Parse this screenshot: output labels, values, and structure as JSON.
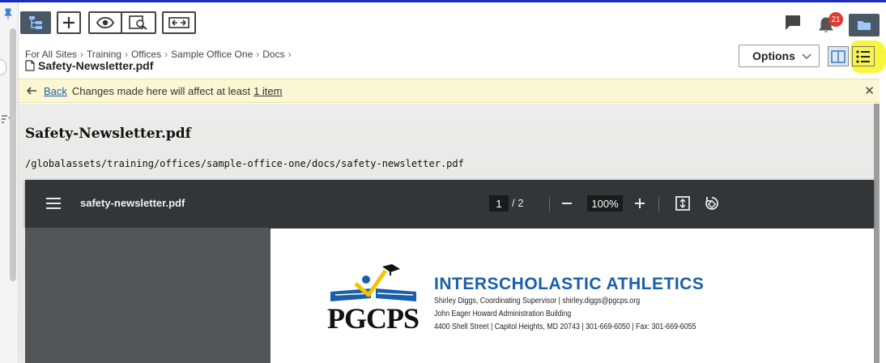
{
  "toolbar": {
    "notification_count": "21"
  },
  "breadcrumbs": [
    "For All Sites",
    "Training",
    "Offices",
    "Sample Office One",
    "Docs"
  ],
  "file": {
    "name": "Safety-Newsletter.pdf"
  },
  "options": {
    "label": "Options"
  },
  "notice": {
    "back": "Back",
    "message": "Changes made here will affect at least",
    "link": "1 item"
  },
  "document": {
    "title": "Safety-Newsletter.pdf",
    "path": "/globalassets/training/offices/sample-office-one/docs/safety-newsletter.pdf"
  },
  "pdf_viewer": {
    "filename": "safety-newsletter.pdf",
    "current_page": "1",
    "page_total": "/ 2",
    "zoom": "100%"
  },
  "letterhead": {
    "logo_text": "PGCPS",
    "title": "INTERSCHOLASTIC ATHLETICS",
    "lines": [
      "Shirley Diggs, Coordinating Supervisor | shirley.diggs@pgcps.org",
      "John Eager Howard Administration Building",
      "4400 Shell Street | Capitol Heights, MD 20743 | 301-669-6050  |  Fax: 301-669-6055"
    ]
  },
  "colors": {
    "accent_blue": "#1a5fa8",
    "toolbar_dark": "#4a5866",
    "notice_bg": "#fbf7d2",
    "highlight": "#f9f53a",
    "badge": "#e0392d"
  }
}
